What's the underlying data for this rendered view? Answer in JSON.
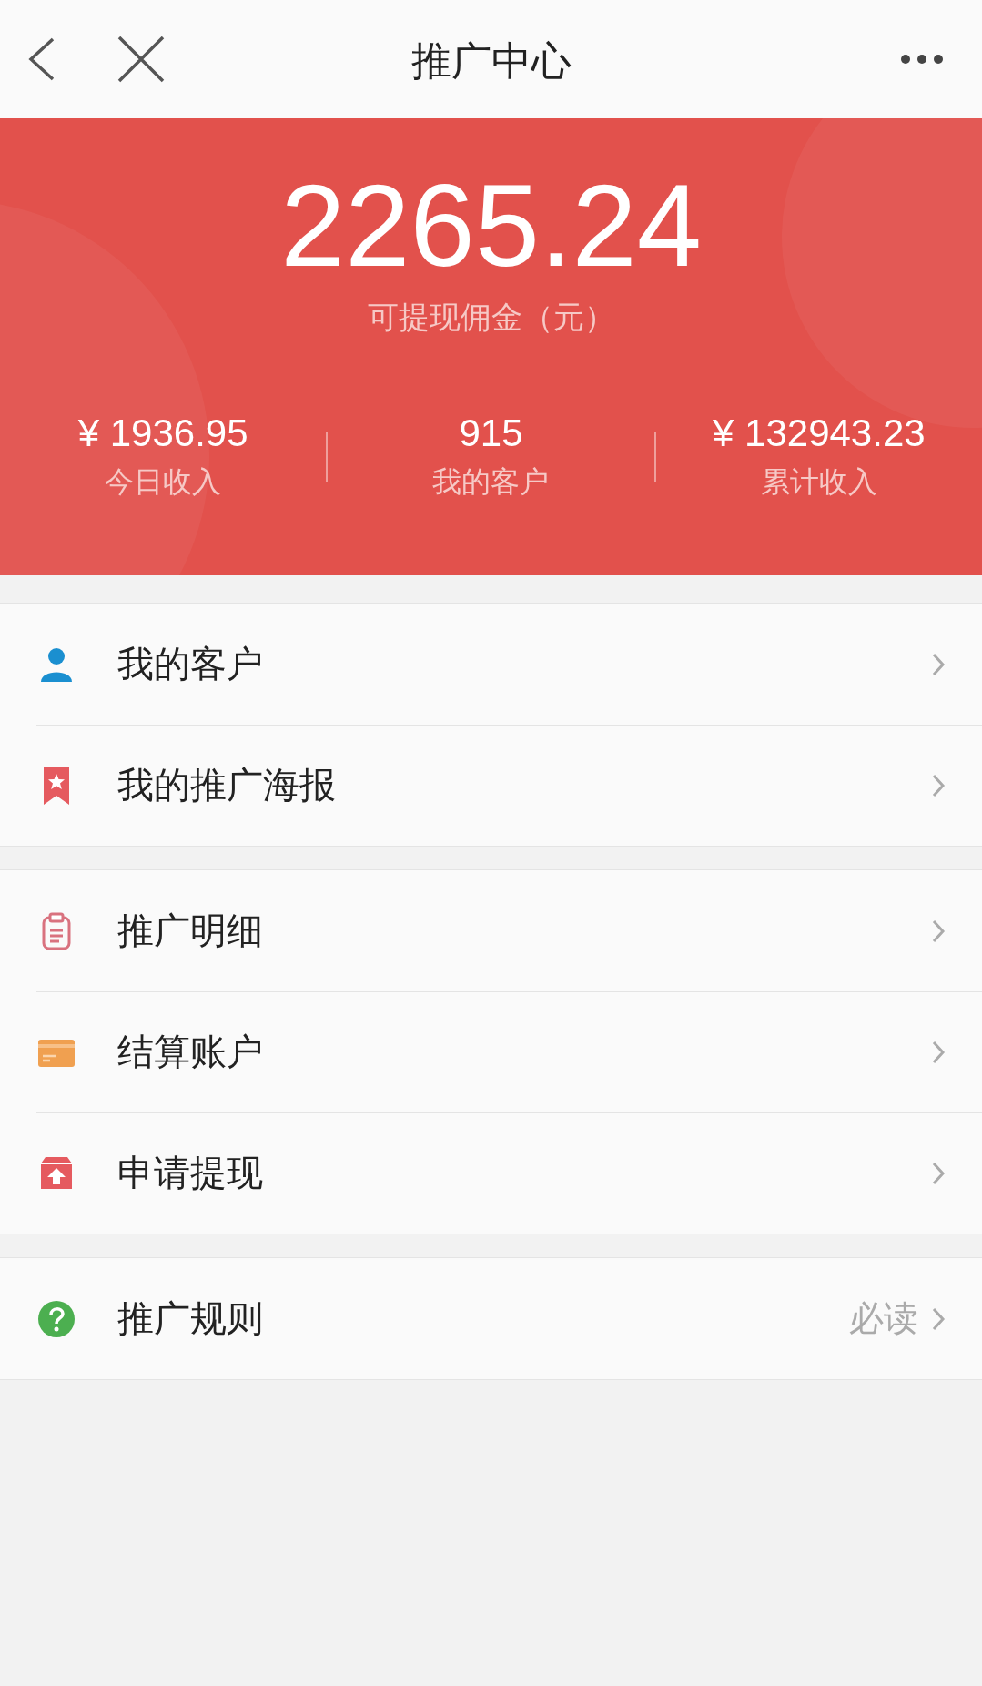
{
  "header": {
    "title": "推广中心"
  },
  "summary": {
    "amount": "2265.24",
    "amount_label": "可提现佣金（元）",
    "stats": [
      {
        "value": "¥ 1936.95",
        "label": "今日收入"
      },
      {
        "value": "915",
        "label": "我的客户"
      },
      {
        "value": "¥ 132943.23",
        "label": "累计收入"
      }
    ]
  },
  "menu_groups": [
    {
      "items": [
        {
          "kind": "person",
          "label": "我的客户"
        },
        {
          "kind": "bookmark",
          "label": "我的推广海报"
        }
      ]
    },
    {
      "items": [
        {
          "kind": "clipboard",
          "label": "推广明细"
        },
        {
          "kind": "card",
          "label": "结算账户"
        },
        {
          "kind": "upload",
          "label": "申请提现"
        }
      ]
    },
    {
      "items": [
        {
          "kind": "question",
          "label": "推广规则",
          "hint": "必读"
        }
      ]
    }
  ]
}
